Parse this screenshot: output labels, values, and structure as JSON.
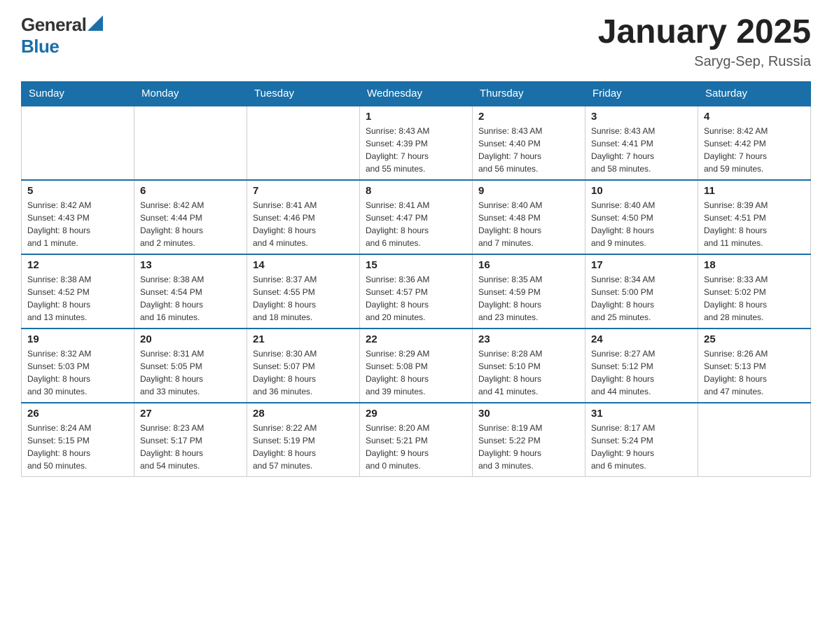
{
  "header": {
    "logo_general": "General",
    "logo_blue": "Blue",
    "month_title": "January 2025",
    "location": "Saryg-Sep, Russia"
  },
  "days_of_week": [
    "Sunday",
    "Monday",
    "Tuesday",
    "Wednesday",
    "Thursday",
    "Friday",
    "Saturday"
  ],
  "weeks": [
    [
      {
        "day": "",
        "info": ""
      },
      {
        "day": "",
        "info": ""
      },
      {
        "day": "",
        "info": ""
      },
      {
        "day": "1",
        "info": "Sunrise: 8:43 AM\nSunset: 4:39 PM\nDaylight: 7 hours\nand 55 minutes."
      },
      {
        "day": "2",
        "info": "Sunrise: 8:43 AM\nSunset: 4:40 PM\nDaylight: 7 hours\nand 56 minutes."
      },
      {
        "day": "3",
        "info": "Sunrise: 8:43 AM\nSunset: 4:41 PM\nDaylight: 7 hours\nand 58 minutes."
      },
      {
        "day": "4",
        "info": "Sunrise: 8:42 AM\nSunset: 4:42 PM\nDaylight: 7 hours\nand 59 minutes."
      }
    ],
    [
      {
        "day": "5",
        "info": "Sunrise: 8:42 AM\nSunset: 4:43 PM\nDaylight: 8 hours\nand 1 minute."
      },
      {
        "day": "6",
        "info": "Sunrise: 8:42 AM\nSunset: 4:44 PM\nDaylight: 8 hours\nand 2 minutes."
      },
      {
        "day": "7",
        "info": "Sunrise: 8:41 AM\nSunset: 4:46 PM\nDaylight: 8 hours\nand 4 minutes."
      },
      {
        "day": "8",
        "info": "Sunrise: 8:41 AM\nSunset: 4:47 PM\nDaylight: 8 hours\nand 6 minutes."
      },
      {
        "day": "9",
        "info": "Sunrise: 8:40 AM\nSunset: 4:48 PM\nDaylight: 8 hours\nand 7 minutes."
      },
      {
        "day": "10",
        "info": "Sunrise: 8:40 AM\nSunset: 4:50 PM\nDaylight: 8 hours\nand 9 minutes."
      },
      {
        "day": "11",
        "info": "Sunrise: 8:39 AM\nSunset: 4:51 PM\nDaylight: 8 hours\nand 11 minutes."
      }
    ],
    [
      {
        "day": "12",
        "info": "Sunrise: 8:38 AM\nSunset: 4:52 PM\nDaylight: 8 hours\nand 13 minutes."
      },
      {
        "day": "13",
        "info": "Sunrise: 8:38 AM\nSunset: 4:54 PM\nDaylight: 8 hours\nand 16 minutes."
      },
      {
        "day": "14",
        "info": "Sunrise: 8:37 AM\nSunset: 4:55 PM\nDaylight: 8 hours\nand 18 minutes."
      },
      {
        "day": "15",
        "info": "Sunrise: 8:36 AM\nSunset: 4:57 PM\nDaylight: 8 hours\nand 20 minutes."
      },
      {
        "day": "16",
        "info": "Sunrise: 8:35 AM\nSunset: 4:59 PM\nDaylight: 8 hours\nand 23 minutes."
      },
      {
        "day": "17",
        "info": "Sunrise: 8:34 AM\nSunset: 5:00 PM\nDaylight: 8 hours\nand 25 minutes."
      },
      {
        "day": "18",
        "info": "Sunrise: 8:33 AM\nSunset: 5:02 PM\nDaylight: 8 hours\nand 28 minutes."
      }
    ],
    [
      {
        "day": "19",
        "info": "Sunrise: 8:32 AM\nSunset: 5:03 PM\nDaylight: 8 hours\nand 30 minutes."
      },
      {
        "day": "20",
        "info": "Sunrise: 8:31 AM\nSunset: 5:05 PM\nDaylight: 8 hours\nand 33 minutes."
      },
      {
        "day": "21",
        "info": "Sunrise: 8:30 AM\nSunset: 5:07 PM\nDaylight: 8 hours\nand 36 minutes."
      },
      {
        "day": "22",
        "info": "Sunrise: 8:29 AM\nSunset: 5:08 PM\nDaylight: 8 hours\nand 39 minutes."
      },
      {
        "day": "23",
        "info": "Sunrise: 8:28 AM\nSunset: 5:10 PM\nDaylight: 8 hours\nand 41 minutes."
      },
      {
        "day": "24",
        "info": "Sunrise: 8:27 AM\nSunset: 5:12 PM\nDaylight: 8 hours\nand 44 minutes."
      },
      {
        "day": "25",
        "info": "Sunrise: 8:26 AM\nSunset: 5:13 PM\nDaylight: 8 hours\nand 47 minutes."
      }
    ],
    [
      {
        "day": "26",
        "info": "Sunrise: 8:24 AM\nSunset: 5:15 PM\nDaylight: 8 hours\nand 50 minutes."
      },
      {
        "day": "27",
        "info": "Sunrise: 8:23 AM\nSunset: 5:17 PM\nDaylight: 8 hours\nand 54 minutes."
      },
      {
        "day": "28",
        "info": "Sunrise: 8:22 AM\nSunset: 5:19 PM\nDaylight: 8 hours\nand 57 minutes."
      },
      {
        "day": "29",
        "info": "Sunrise: 8:20 AM\nSunset: 5:21 PM\nDaylight: 9 hours\nand 0 minutes."
      },
      {
        "day": "30",
        "info": "Sunrise: 8:19 AM\nSunset: 5:22 PM\nDaylight: 9 hours\nand 3 minutes."
      },
      {
        "day": "31",
        "info": "Sunrise: 8:17 AM\nSunset: 5:24 PM\nDaylight: 9 hours\nand 6 minutes."
      },
      {
        "day": "",
        "info": ""
      }
    ]
  ]
}
